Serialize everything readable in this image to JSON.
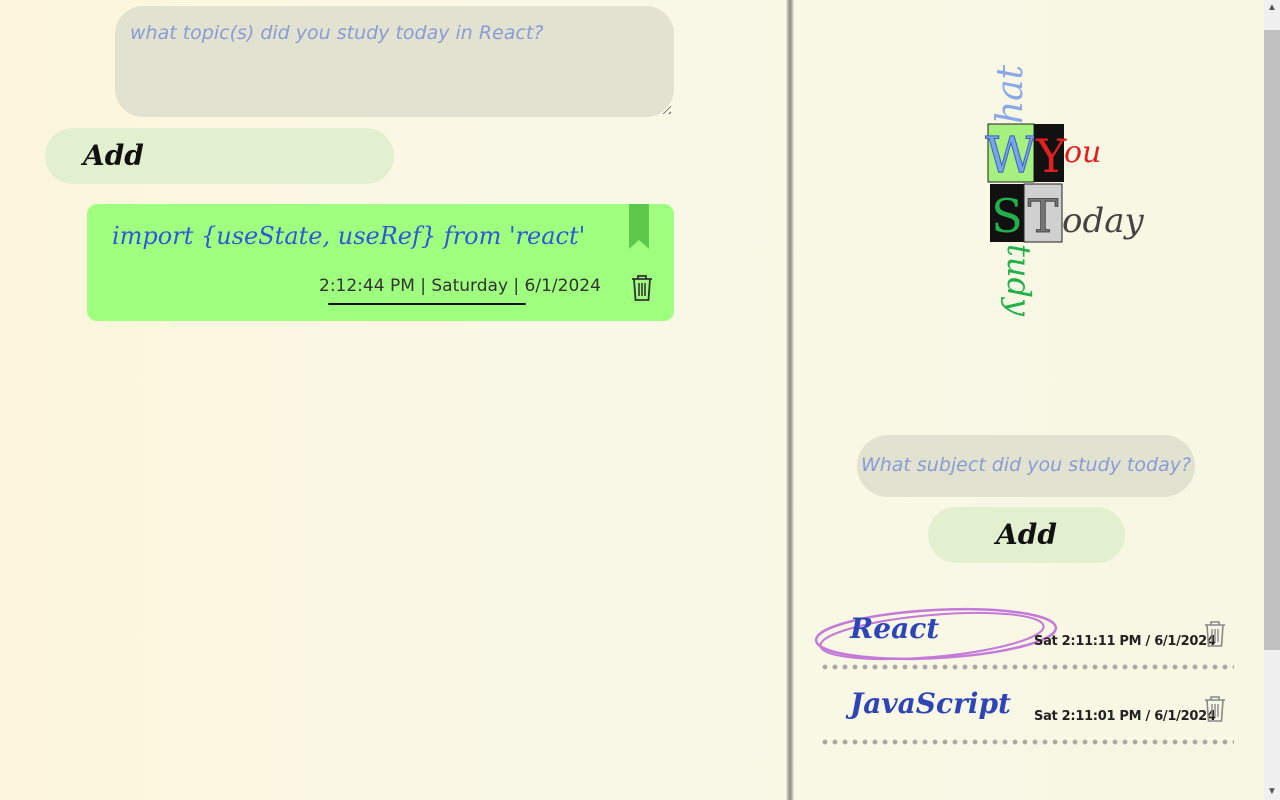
{
  "left": {
    "topic_placeholder": "what topic(s) did you study today in React?",
    "add_label": "Add",
    "note": {
      "text": "import {useState, useRef} from 'react'",
      "meta": "2:12:44 PM | Saturday | 6/1/2024"
    }
  },
  "logo": {
    "letters": [
      "W",
      "Y",
      "S",
      "T"
    ],
    "words": [
      "hat",
      "ou",
      "tudy",
      "oday"
    ],
    "colors": {
      "what": "#8aa8e8",
      "you": "#e02020",
      "study": "#22b04a",
      "today": "#444444"
    }
  },
  "right": {
    "subject_placeholder": "What subject did you study today?",
    "add_label": "Add",
    "subjects": [
      {
        "name": "React",
        "time": "Sat 2:11:11 PM / 6/1/2024"
      },
      {
        "name": "JavaScript",
        "time": "Sat 2:11:01 PM / 6/1/2024"
      }
    ]
  },
  "colors": {
    "note_bg": "#9fff7f",
    "input_bg": "#e2e2d0",
    "button_bg": "#e2f0d0",
    "subject_text": "#2e45b8"
  }
}
